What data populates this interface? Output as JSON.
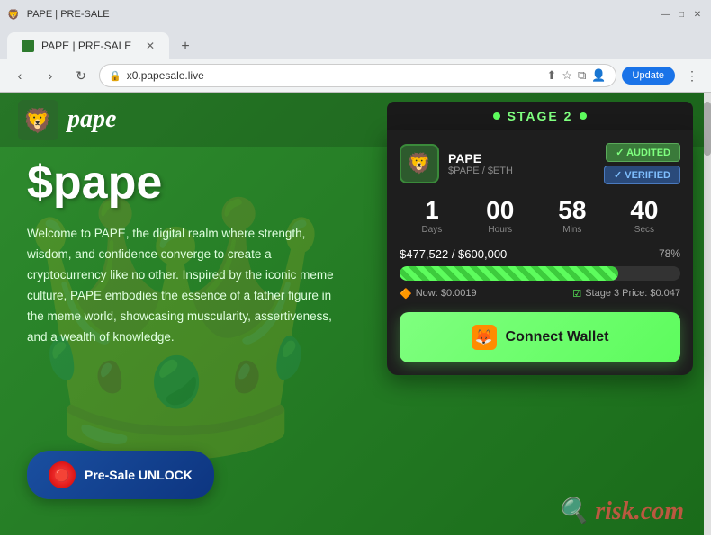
{
  "browser": {
    "tab_title": "PAPE | PRE-SALE",
    "url": "x0.papesale.live",
    "nav_back": "‹",
    "nav_forward": "›",
    "nav_refresh": "↻",
    "new_tab": "+",
    "tab_close": "✕",
    "update_btn": "Update",
    "toolbar": {
      "share_icon": "⇧",
      "star_icon": "☆",
      "profile_icon": "👤",
      "menu_icon": "⋮",
      "extensions_icon": "⧉"
    },
    "window_controls": {
      "minimize": "—",
      "maximize": "□",
      "close": "✕"
    }
  },
  "site": {
    "logo_text": "pape",
    "hero_title": "$pape",
    "hero_desc": "Welcome to PAPE, the digital realm where strength, wisdom, and confidence converge to create a cryptocurrency like no other. Inspired by the iconic meme culture, PAPE embodies the essence of a father figure in the meme world, showcasing muscularity, assertiveness, and a wealth of knowledge.",
    "presale_btn": "Pre-Sale UNLOCK"
  },
  "presale_card": {
    "stage_label": "STAGE 2",
    "stage_dot_color": "#5dfc5d",
    "token_name": "PAPE",
    "token_pair": "$PAPE / $ETH",
    "badge_audited": "✓ AUDITED",
    "badge_verified": "✓ VERIFIED",
    "countdown": {
      "days_val": "1",
      "days_label": "Days",
      "hours_val": "00",
      "hours_label": "Hours",
      "mins_val": "58",
      "mins_label": "Mins",
      "secs_val": "40",
      "secs_label": "Secs"
    },
    "raised_text": "$477,522 / $600,000",
    "progress_pct": "78%",
    "progress_width": "78%",
    "price_now_label": "Now: $0.0019",
    "price_stage3_label": "Stage 3 Price: $0.047",
    "connect_wallet_label": "Connect Wallet"
  },
  "watermark": {
    "icon": "🔍",
    "text": "risk.com"
  },
  "colors": {
    "page_bg": "#2e8b2e",
    "card_bg": "#1e1e1e",
    "stage_banner_bg": "#1a1a1a",
    "accent_green": "#5dfc5d",
    "connect_btn_bg": "#7fff7f"
  }
}
